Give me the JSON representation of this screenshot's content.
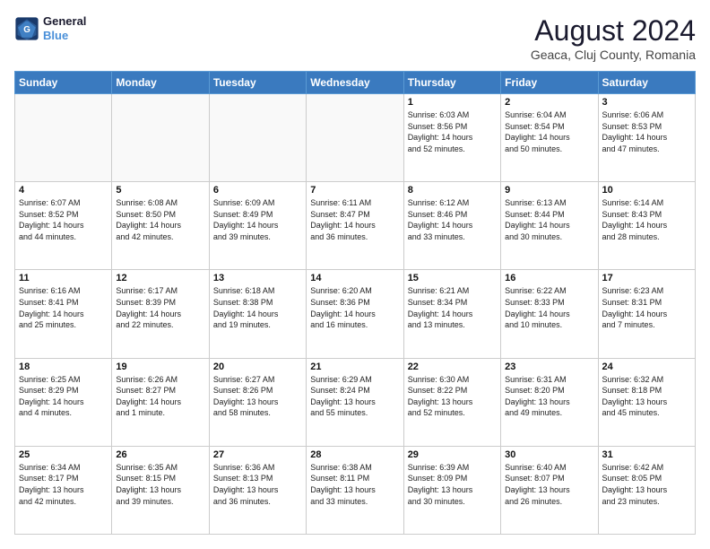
{
  "logo": {
    "line1": "General",
    "line2": "Blue"
  },
  "title": "August 2024",
  "subtitle": "Geaca, Cluj County, Romania",
  "days_of_week": [
    "Sunday",
    "Monday",
    "Tuesday",
    "Wednesday",
    "Thursday",
    "Friday",
    "Saturday"
  ],
  "weeks": [
    [
      {
        "day": "",
        "info": ""
      },
      {
        "day": "",
        "info": ""
      },
      {
        "day": "",
        "info": ""
      },
      {
        "day": "",
        "info": ""
      },
      {
        "day": "1",
        "info": "Sunrise: 6:03 AM\nSunset: 8:56 PM\nDaylight: 14 hours\nand 52 minutes."
      },
      {
        "day": "2",
        "info": "Sunrise: 6:04 AM\nSunset: 8:54 PM\nDaylight: 14 hours\nand 50 minutes."
      },
      {
        "day": "3",
        "info": "Sunrise: 6:06 AM\nSunset: 8:53 PM\nDaylight: 14 hours\nand 47 minutes."
      }
    ],
    [
      {
        "day": "4",
        "info": "Sunrise: 6:07 AM\nSunset: 8:52 PM\nDaylight: 14 hours\nand 44 minutes."
      },
      {
        "day": "5",
        "info": "Sunrise: 6:08 AM\nSunset: 8:50 PM\nDaylight: 14 hours\nand 42 minutes."
      },
      {
        "day": "6",
        "info": "Sunrise: 6:09 AM\nSunset: 8:49 PM\nDaylight: 14 hours\nand 39 minutes."
      },
      {
        "day": "7",
        "info": "Sunrise: 6:11 AM\nSunset: 8:47 PM\nDaylight: 14 hours\nand 36 minutes."
      },
      {
        "day": "8",
        "info": "Sunrise: 6:12 AM\nSunset: 8:46 PM\nDaylight: 14 hours\nand 33 minutes."
      },
      {
        "day": "9",
        "info": "Sunrise: 6:13 AM\nSunset: 8:44 PM\nDaylight: 14 hours\nand 30 minutes."
      },
      {
        "day": "10",
        "info": "Sunrise: 6:14 AM\nSunset: 8:43 PM\nDaylight: 14 hours\nand 28 minutes."
      }
    ],
    [
      {
        "day": "11",
        "info": "Sunrise: 6:16 AM\nSunset: 8:41 PM\nDaylight: 14 hours\nand 25 minutes."
      },
      {
        "day": "12",
        "info": "Sunrise: 6:17 AM\nSunset: 8:39 PM\nDaylight: 14 hours\nand 22 minutes."
      },
      {
        "day": "13",
        "info": "Sunrise: 6:18 AM\nSunset: 8:38 PM\nDaylight: 14 hours\nand 19 minutes."
      },
      {
        "day": "14",
        "info": "Sunrise: 6:20 AM\nSunset: 8:36 PM\nDaylight: 14 hours\nand 16 minutes."
      },
      {
        "day": "15",
        "info": "Sunrise: 6:21 AM\nSunset: 8:34 PM\nDaylight: 14 hours\nand 13 minutes."
      },
      {
        "day": "16",
        "info": "Sunrise: 6:22 AM\nSunset: 8:33 PM\nDaylight: 14 hours\nand 10 minutes."
      },
      {
        "day": "17",
        "info": "Sunrise: 6:23 AM\nSunset: 8:31 PM\nDaylight: 14 hours\nand 7 minutes."
      }
    ],
    [
      {
        "day": "18",
        "info": "Sunrise: 6:25 AM\nSunset: 8:29 PM\nDaylight: 14 hours\nand 4 minutes."
      },
      {
        "day": "19",
        "info": "Sunrise: 6:26 AM\nSunset: 8:27 PM\nDaylight: 14 hours\nand 1 minute."
      },
      {
        "day": "20",
        "info": "Sunrise: 6:27 AM\nSunset: 8:26 PM\nDaylight: 13 hours\nand 58 minutes."
      },
      {
        "day": "21",
        "info": "Sunrise: 6:29 AM\nSunset: 8:24 PM\nDaylight: 13 hours\nand 55 minutes."
      },
      {
        "day": "22",
        "info": "Sunrise: 6:30 AM\nSunset: 8:22 PM\nDaylight: 13 hours\nand 52 minutes."
      },
      {
        "day": "23",
        "info": "Sunrise: 6:31 AM\nSunset: 8:20 PM\nDaylight: 13 hours\nand 49 minutes."
      },
      {
        "day": "24",
        "info": "Sunrise: 6:32 AM\nSunset: 8:18 PM\nDaylight: 13 hours\nand 45 minutes."
      }
    ],
    [
      {
        "day": "25",
        "info": "Sunrise: 6:34 AM\nSunset: 8:17 PM\nDaylight: 13 hours\nand 42 minutes."
      },
      {
        "day": "26",
        "info": "Sunrise: 6:35 AM\nSunset: 8:15 PM\nDaylight: 13 hours\nand 39 minutes."
      },
      {
        "day": "27",
        "info": "Sunrise: 6:36 AM\nSunset: 8:13 PM\nDaylight: 13 hours\nand 36 minutes."
      },
      {
        "day": "28",
        "info": "Sunrise: 6:38 AM\nSunset: 8:11 PM\nDaylight: 13 hours\nand 33 minutes."
      },
      {
        "day": "29",
        "info": "Sunrise: 6:39 AM\nSunset: 8:09 PM\nDaylight: 13 hours\nand 30 minutes."
      },
      {
        "day": "30",
        "info": "Sunrise: 6:40 AM\nSunset: 8:07 PM\nDaylight: 13 hours\nand 26 minutes."
      },
      {
        "day": "31",
        "info": "Sunrise: 6:42 AM\nSunset: 8:05 PM\nDaylight: 13 hours\nand 23 minutes."
      }
    ]
  ]
}
